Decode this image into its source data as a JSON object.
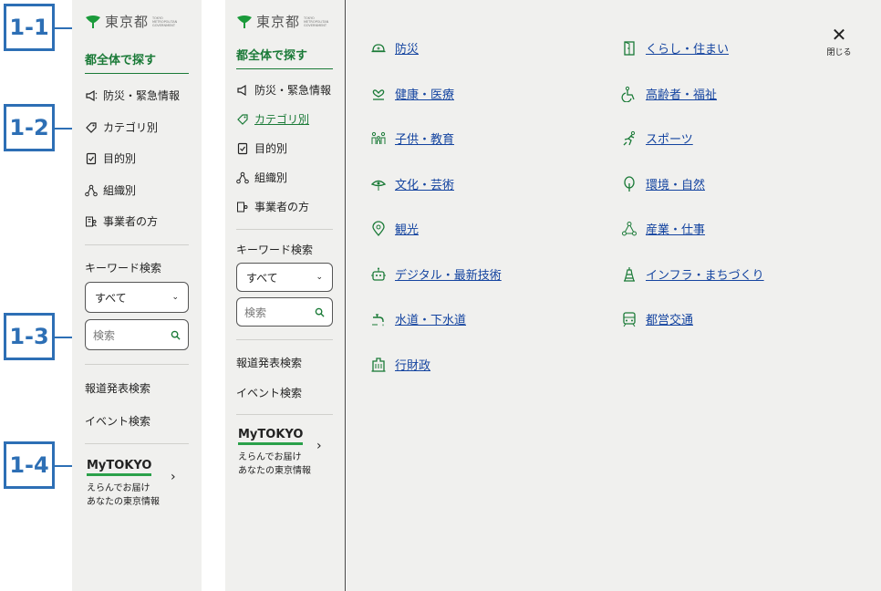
{
  "annotations": [
    "1-1",
    "1-2",
    "1-3",
    "1-4"
  ],
  "logo": {
    "text": "東京都",
    "sub": "TOKYO METROPOLITAN GOVERNMENT"
  },
  "section_title": "都全体で探す",
  "nav": [
    {
      "label": "防災・緊急情報",
      "icon": "megaphone-icon"
    },
    {
      "label": "カテゴリ別",
      "icon": "tag-icon"
    },
    {
      "label": "目的別",
      "icon": "checklist-icon"
    },
    {
      "label": "組織別",
      "icon": "org-chart-icon"
    },
    {
      "label": "事業者の方",
      "icon": "business-icon"
    }
  ],
  "keyword_search": {
    "label": "キーワード検索",
    "select_value": "すべて",
    "search_placeholder": "検索"
  },
  "links": [
    "報道発表検索",
    "イベント検索"
  ],
  "mytokyo": {
    "logo": "MyTOKYO",
    "line1": "えらんでお届け",
    "line2": "あなたの東京情報"
  },
  "close": {
    "label": "閉じる"
  },
  "categories_left": [
    {
      "label": "防災",
      "icon": "helmet-icon"
    },
    {
      "label": "健康・医療",
      "icon": "health-icon"
    },
    {
      "label": "子供・教育",
      "icon": "family-icon"
    },
    {
      "label": "文化・芸術",
      "icon": "culture-icon"
    },
    {
      "label": "観光",
      "icon": "map-pin-icon"
    },
    {
      "label": "デジタル・最新技術",
      "icon": "robot-icon"
    },
    {
      "label": "水道・下水道",
      "icon": "faucet-icon"
    },
    {
      "label": "行財政",
      "icon": "government-building-icon"
    }
  ],
  "categories_right": [
    {
      "label": "くらし・住まい",
      "icon": "door-icon"
    },
    {
      "label": "高齢者・福祉",
      "icon": "wheelchair-icon"
    },
    {
      "label": "スポーツ",
      "icon": "runner-icon"
    },
    {
      "label": "環境・自然",
      "icon": "tree-icon"
    },
    {
      "label": "産業・仕事",
      "icon": "industry-icon"
    },
    {
      "label": "インフラ・まちづくり",
      "icon": "tower-icon"
    },
    {
      "label": "都営交通",
      "icon": "train-icon"
    }
  ],
  "colors": {
    "accent_green": "#1a7a37",
    "link_blue": "#1444a0",
    "annotation_blue": "#2d6fb5",
    "panel_bg": "#f0f0ee"
  }
}
